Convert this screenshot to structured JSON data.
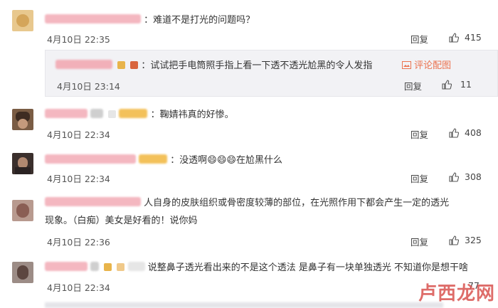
{
  "comments": [
    {
      "text": "：难道不是打光的问题吗？",
      "time": "4月10日 22:35",
      "reply": "回复",
      "likes": "415"
    },
    {
      "text": "：试试把手电筒照手指上看一下透不透光尬黑的令人发指",
      "link": "评论配图",
      "time": "4月10日 23:14",
      "reply": "回复",
      "likes": "11"
    },
    {
      "text": "：鞠婧祎真的好惨。",
      "time": "4月10日 22:34",
      "reply": "回复",
      "likes": "408"
    },
    {
      "text": "：没透啊😄😄😄在尬黑什么",
      "time": "4月10日 22:34",
      "reply": "回复",
      "likes": "308"
    },
    {
      "text_line1": "人自身的皮肤组织或骨密度较薄的部位，在光照作用下都会产生一定的透光",
      "text_line2": "现象。（白痴）美女是好看的！说你妈",
      "time": "4月10日 22:36",
      "reply": "回复",
      "likes": "325"
    },
    {
      "text": "说整鼻子透光看出来的不是这个透法 是鼻子有一块单独透光 不知道你是想干啥",
      "time": "4月10日 22:34",
      "reply": "回复",
      "likes": "77"
    }
  ],
  "watermark": "卢西龙网",
  "colors": {
    "link": "#eb7350",
    "subbox_bg": "#f2f2f5"
  }
}
